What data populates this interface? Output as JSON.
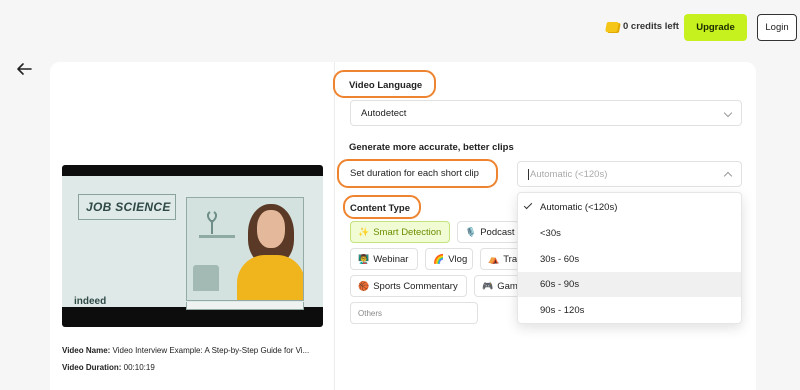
{
  "header": {
    "credits": "0 credits left",
    "upgrade_label": "Upgrade",
    "login_label": "Login"
  },
  "video": {
    "thumbnail_title": "JOB SCIENCE",
    "thumbnail_brand": "indeed",
    "name_label": "Video Name:",
    "name_value": "Video Interview Example: A Step-by-Step Guide for Vi...",
    "duration_label": "Video Duration:",
    "duration_value": "00:10:19"
  },
  "settings": {
    "language_title": "Video Language",
    "language_value": "Autodetect",
    "accurate_title": "Generate more accurate, better clips",
    "duration_title": "Set duration for each short clip",
    "duration_placeholder": "Automatic (<120s)",
    "content_title": "Content Type",
    "content_types": [
      {
        "label": "Smart Detection",
        "icon": "sparkle-icon",
        "active": true
      },
      {
        "label": "Podcast",
        "icon": "microphone-icon"
      },
      {
        "label": "Webinar",
        "icon": "presenter-icon"
      },
      {
        "label": "Vlog",
        "icon": "rainbow-icon"
      },
      {
        "label": "Trav",
        "icon": "tent-icon"
      },
      {
        "label": "Sports Commentary",
        "icon": "basketball-icon"
      },
      {
        "label": "Gam",
        "icon": "gamepad-icon"
      }
    ],
    "others_placeholder": "Others"
  },
  "duration_dropdown": {
    "options": [
      "Automatic (<120s)",
      "<30s",
      "30s - 60s",
      "60s - 90s",
      "90s - 120s"
    ],
    "selected": "Automatic (<120s)",
    "hovered": "60s - 90s"
  },
  "colors": {
    "highlight": "#ee8430",
    "accent": "#c6f01e",
    "chip_active_text": "#6b8e00"
  }
}
